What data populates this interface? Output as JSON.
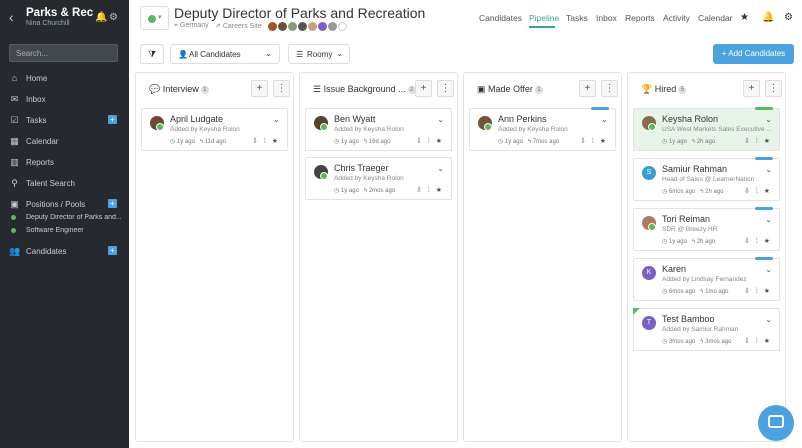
{
  "sidebar": {
    "title": "Parks & Rec",
    "subtitle": "Nina Churchill",
    "search_placeholder": "Search...",
    "nav": [
      {
        "label": "Home",
        "icon": "home-icon"
      },
      {
        "label": "Inbox",
        "icon": "inbox-icon"
      },
      {
        "label": "Tasks",
        "icon": "tasks-icon"
      },
      {
        "label": "Calendar",
        "icon": "calendar-icon"
      },
      {
        "label": "Reports",
        "icon": "reports-icon"
      },
      {
        "label": "Talent Search",
        "icon": "search-icon"
      },
      {
        "label": "Positions / Pools",
        "icon": "briefcase-icon"
      },
      {
        "label": "Candidates",
        "icon": "users-icon"
      }
    ],
    "positions": [
      "Deputy Director of Parks and...",
      "Software Engineer"
    ]
  },
  "header": {
    "title": "Deputy Director of Parks and Recreation",
    "location": "Germany",
    "careers_site": "Careers Site",
    "tabs": [
      "Candidates",
      "Pipeline",
      "Tasks",
      "Inbox",
      "Reports",
      "Activity",
      "Calendar"
    ],
    "active_tab": "Pipeline"
  },
  "toolbar": {
    "filter_label": "All Candidates",
    "view_label": "Roomy",
    "add_label": "+ Add Candidates"
  },
  "columns": [
    {
      "title": "Interview",
      "count": "1",
      "icon": "chat-icon",
      "cards": [
        {
          "name": "April Ludgate",
          "sub": "Added by Keysha Rolon",
          "t1": "1y ago",
          "t2": "11d ago"
        }
      ]
    },
    {
      "title": "Issue Background ...",
      "count": "2",
      "icon": "list-icon",
      "cards": [
        {
          "name": "Ben Wyatt",
          "sub": "Added by Keysha Rolon",
          "t1": "1y ago",
          "t2": "16d ago"
        },
        {
          "name": "Chris Traeger",
          "sub": "Added by Keysha Rolon",
          "t1": "1y ago",
          "t2": "2mos ago"
        }
      ]
    },
    {
      "title": "Made Offer",
      "count": "1",
      "icon": "briefcase-icon",
      "cards": [
        {
          "name": "Ann Perkins",
          "sub": "Added by Keysha Rolon",
          "t1": "1y ago",
          "t2": "7mos ago"
        }
      ]
    },
    {
      "title": "Hired",
      "count": "5",
      "icon": "trophy-icon",
      "cards": [
        {
          "name": "Keysha Rolon",
          "sub": "USA West Markets Sales Executive ...",
          "t1": "1y ago",
          "t2": "2h ago"
        },
        {
          "name": "Samiur Rahman",
          "sub": "Head of Sales @ LearnerNation",
          "t1": "6mos ago",
          "t2": "2h ago",
          "initial": "S"
        },
        {
          "name": "Tori Reiman",
          "sub": "SDR @ Breezy HR",
          "t1": "1y ago",
          "t2": "2h ago"
        },
        {
          "name": "Karen",
          "sub": "Added by Lindsay Fernandez",
          "t1": "6mos ago",
          "t2": "1mo ago",
          "initial": "K"
        },
        {
          "name": "Test Bamboo",
          "sub": "Added by Samiur Rahman",
          "t1": "3mos ago",
          "t2": "3mos ago",
          "initial": "T"
        }
      ]
    }
  ]
}
